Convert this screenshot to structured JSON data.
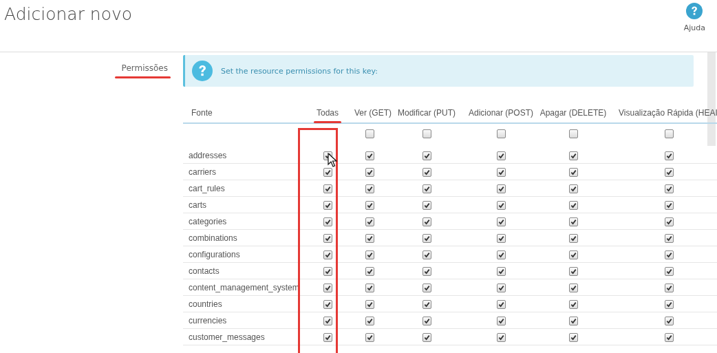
{
  "header": {
    "title": "Adicionar novo",
    "help_label": "Ajuda"
  },
  "form": {
    "label": "Permissões",
    "label_underlined": true,
    "info": "Set the resource permissions for this key:"
  },
  "table": {
    "columns": [
      {
        "label": "Fonte",
        "underlined": false,
        "highlighted": false
      },
      {
        "label": "Todas",
        "underlined": true,
        "highlighted": true
      },
      {
        "label": "Ver (GET)",
        "underlined": false,
        "highlighted": false
      },
      {
        "label": "Modificar (PUT)",
        "underlined": false,
        "highlighted": false
      },
      {
        "label": "Adicionar (POST)",
        "underlined": false,
        "highlighted": false
      },
      {
        "label": "Apagar (DELETE)",
        "underlined": false,
        "highlighted": false
      },
      {
        "label": "Visualização Rápida (HEAI",
        "underlined": false,
        "highlighted": false
      }
    ],
    "select_all": [
      false,
      false,
      false,
      false,
      false
    ],
    "rows": [
      {
        "name": "addresses",
        "checked": [
          true,
          true,
          true,
          true,
          true,
          true
        ]
      },
      {
        "name": "carriers",
        "checked": [
          true,
          true,
          true,
          true,
          true,
          true
        ]
      },
      {
        "name": "cart_rules",
        "checked": [
          true,
          true,
          true,
          true,
          true,
          true
        ]
      },
      {
        "name": "carts",
        "checked": [
          true,
          true,
          true,
          true,
          true,
          true
        ]
      },
      {
        "name": "categories",
        "checked": [
          true,
          true,
          true,
          true,
          true,
          true
        ]
      },
      {
        "name": "combinations",
        "checked": [
          true,
          true,
          true,
          true,
          true,
          true
        ]
      },
      {
        "name": "configurations",
        "checked": [
          true,
          true,
          true,
          true,
          true,
          true
        ]
      },
      {
        "name": "contacts",
        "checked": [
          true,
          true,
          true,
          true,
          true,
          true
        ]
      },
      {
        "name": "content_management_system",
        "checked": [
          true,
          true,
          true,
          true,
          true,
          true
        ]
      },
      {
        "name": "countries",
        "checked": [
          true,
          true,
          true,
          true,
          true,
          true
        ]
      },
      {
        "name": "currencies",
        "checked": [
          true,
          true,
          true,
          true,
          true,
          true
        ]
      },
      {
        "name": "customer_messages",
        "checked": [
          true,
          true,
          true,
          true,
          true,
          true
        ]
      }
    ]
  }
}
